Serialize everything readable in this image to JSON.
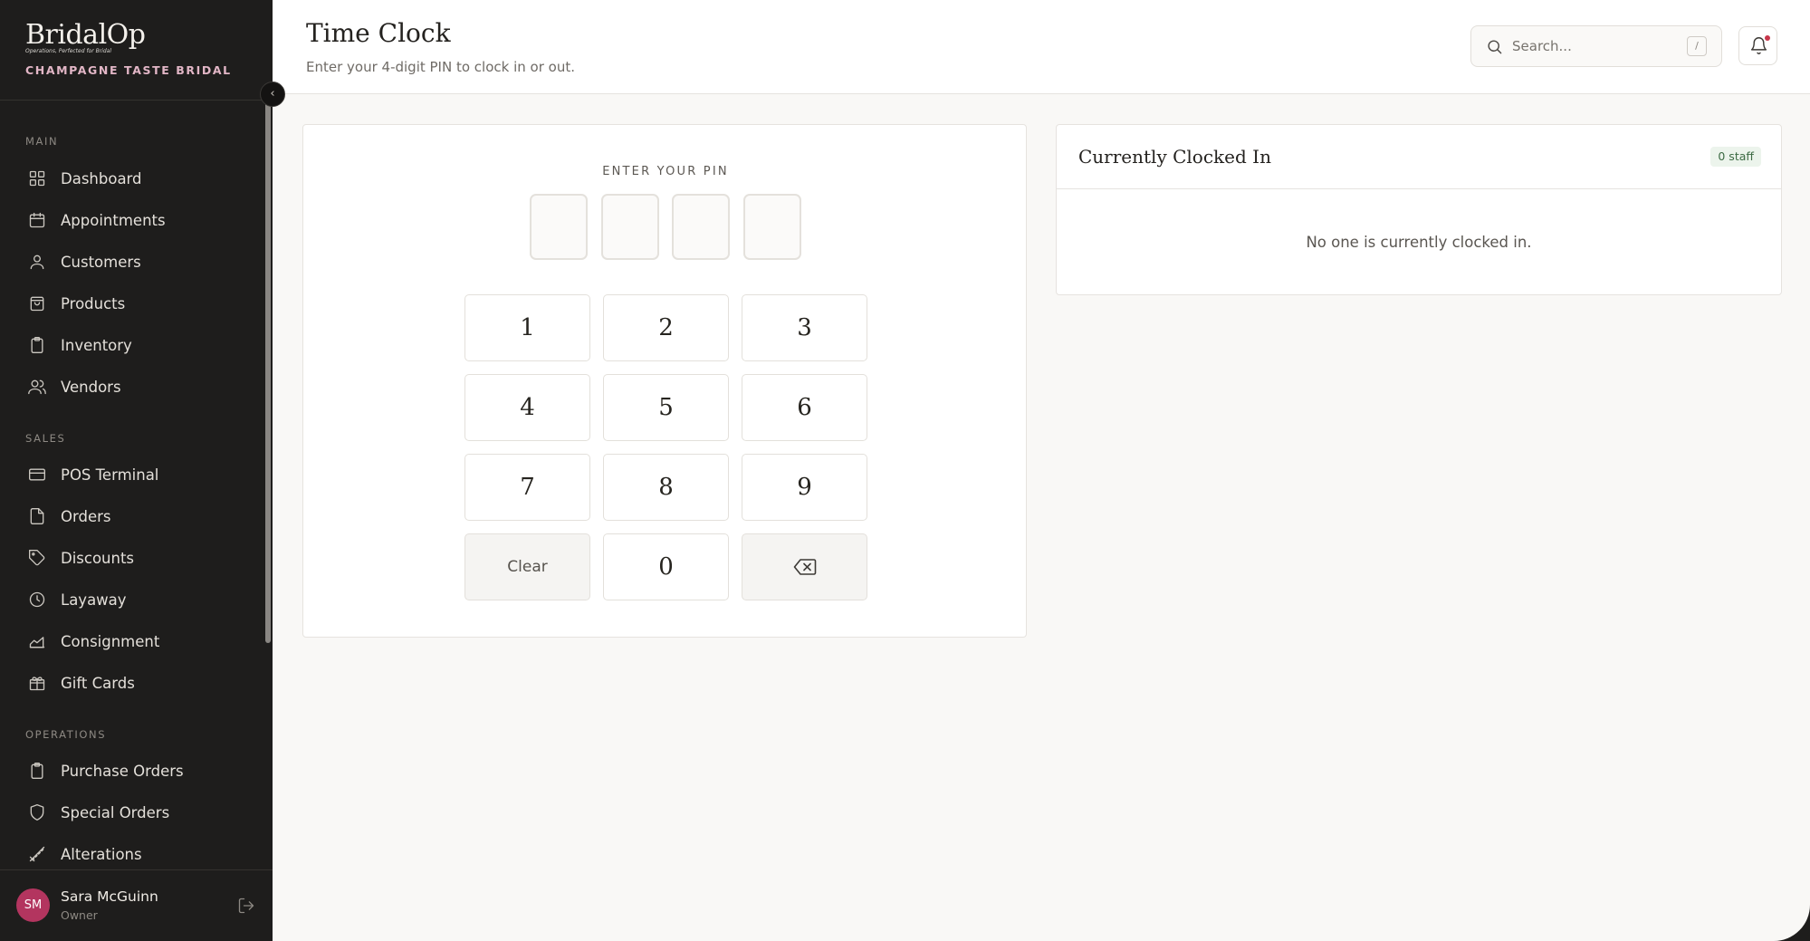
{
  "brand": {
    "logo_text": "BridalOp",
    "tagline": "Operations, Perfected for Bridal",
    "store_name": "CHAMPAGNE TASTE BRIDAL"
  },
  "sidebar": {
    "sections": [
      {
        "label": "MAIN",
        "items": [
          {
            "label": "Dashboard",
            "icon": "grid-icon"
          },
          {
            "label": "Appointments",
            "icon": "calendar-icon"
          },
          {
            "label": "Customers",
            "icon": "user-icon"
          },
          {
            "label": "Products",
            "icon": "shopping-bag-icon"
          },
          {
            "label": "Inventory",
            "icon": "clipboard-icon"
          },
          {
            "label": "Vendors",
            "icon": "users-icon"
          }
        ]
      },
      {
        "label": "SALES",
        "items": [
          {
            "label": "POS Terminal",
            "icon": "credit-card-icon"
          },
          {
            "label": "Orders",
            "icon": "file-icon"
          },
          {
            "label": "Discounts",
            "icon": "tag-icon"
          },
          {
            "label": "Layaway",
            "icon": "clock-icon"
          },
          {
            "label": "Consignment",
            "icon": "area-chart-icon"
          },
          {
            "label": "Gift Cards",
            "icon": "gift-icon"
          }
        ]
      },
      {
        "label": "OPERATIONS",
        "items": [
          {
            "label": "Purchase Orders",
            "icon": "clipboard-icon"
          },
          {
            "label": "Special Orders",
            "icon": "shield-icon"
          },
          {
            "label": "Alterations",
            "icon": "ruler-icon"
          }
        ]
      }
    ],
    "collapse_glyph": "‹"
  },
  "user": {
    "initials": "SM",
    "name": "Sara McGuinn",
    "role": "Owner",
    "avatar_color": "#b3355f"
  },
  "header": {
    "title": "Time Clock",
    "subtitle": "Enter your 4-digit PIN to clock in or out.",
    "search_placeholder": "Search...",
    "search_shortcut": "/",
    "notification_dot": true
  },
  "pin_pad": {
    "label": "ENTER YOUR PIN",
    "digits_entered": [
      "",
      "",
      "",
      ""
    ],
    "keys": [
      "1",
      "2",
      "3",
      "4",
      "5",
      "6",
      "7",
      "8",
      "9",
      "Clear",
      "0",
      "backspace"
    ]
  },
  "clocked_in": {
    "title": "Currently Clocked In",
    "badge": "0 staff",
    "empty_message": "No one is currently clocked in."
  },
  "colors": {
    "sidebar_bg": "#1e1d1c",
    "accent_pink": "#e2b6c6",
    "badge_green_bg": "#ecf4ec",
    "badge_green_text": "#3c6b43"
  }
}
